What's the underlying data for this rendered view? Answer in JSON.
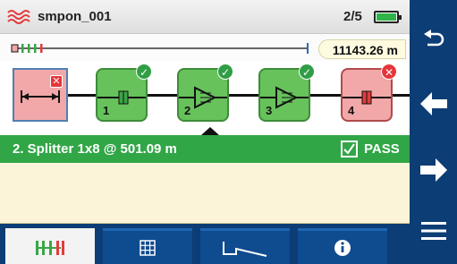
{
  "app": {
    "title": "smpon_001",
    "page_indicator": "2/5"
  },
  "overview": {
    "distance": "11143.26 m"
  },
  "link": {
    "elements": [
      {
        "number": "1",
        "status": "pass"
      },
      {
        "number": "2",
        "status": "pass"
      },
      {
        "number": "3",
        "status": "pass"
      },
      {
        "number": "4",
        "status": "fail"
      }
    ]
  },
  "selection": {
    "label": "2. Splitter 1x8 @ 501.09 m",
    "status_label": "PASS"
  },
  "sidebar": {
    "buttons": [
      "back-icon",
      "previous-event-icon",
      "next-event-icon",
      "menu-icon"
    ]
  },
  "tabs": {
    "items": [
      "link-view-icon",
      "table-icon",
      "trace-icon",
      "info-icon"
    ],
    "active": "link-view-icon"
  },
  "colors": {
    "pass_green": "#31a647",
    "fail_red": "#e5363b",
    "nav_blue": "#0d3d75",
    "detail_bg": "#fbf4d8"
  }
}
